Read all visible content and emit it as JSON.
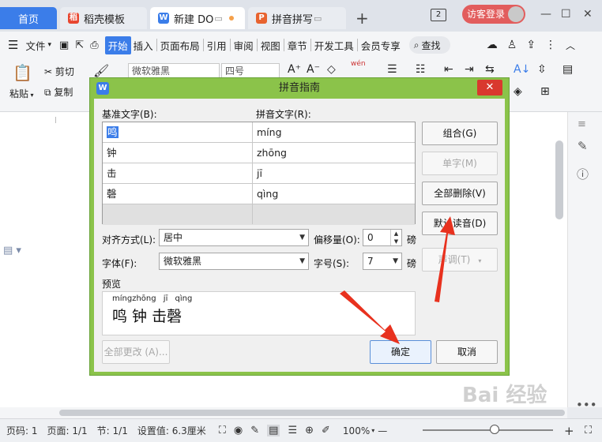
{
  "tabs": [
    {
      "label": "首页"
    },
    {
      "label": "稻壳模板"
    },
    {
      "label": "新建 DO"
    },
    {
      "label": "拼音拼写"
    }
  ],
  "tab_add": "+",
  "page_badge": "2",
  "login_label": "访客登录",
  "window": {
    "minimize": "—",
    "restore": "☐",
    "close": "✕"
  },
  "menu": {
    "file": "文件",
    "items": [
      "开始",
      "插入",
      "页面布局",
      "引用",
      "审阅",
      "视图",
      "章节",
      "开发工具",
      "会员专享"
    ],
    "search": "查找"
  },
  "ribbon": {
    "paste": "粘贴",
    "cut": "剪切",
    "copy": "复制",
    "font": "微软雅黑",
    "size": "四号",
    "wen": "wén"
  },
  "dialog": {
    "title": "拼音指南",
    "close": "✕",
    "base_label": "基准文字(B):",
    "pinyin_label": "拼音文字(R):",
    "rows": [
      {
        "base": "鸣",
        "pinyin": "míng"
      },
      {
        "base": "钟",
        "pinyin": "zhōng"
      },
      {
        "base": "击",
        "pinyin": "jī"
      },
      {
        "base": "磬",
        "pinyin": "qìng"
      }
    ],
    "buttons": {
      "combine": "组合(G)",
      "single": "单字(M)",
      "delete_all": "全部删除(V)",
      "default_reading": "默认读音(D)",
      "tone": "声调(T)",
      "change_all": "全部更改 (A)...",
      "ok": "确定",
      "cancel": "取消"
    },
    "align_label": "对齐方式(L):",
    "align_value": "居中",
    "offset_label": "偏移量(O):",
    "offset_value": "0",
    "offset_unit": "磅",
    "font_label": "字体(F):",
    "font_value": "微软雅黑",
    "size_label": "字号(S):",
    "size_value": "7",
    "size_unit": "磅",
    "preview_label": "预览",
    "preview_pinyin": [
      "míngzhōng",
      "jī",
      "qìng"
    ],
    "preview_text": "鸣 钟 击磬"
  },
  "status": {
    "page_no": "页码: 1",
    "pages": "页面: 1/1",
    "section": "节: 1/1",
    "setting": "设置值: 6.3厘米",
    "zoom": "100%",
    "zoom_minus": "—",
    "zoom_plus": "+"
  },
  "watermark": "Bai 经验"
}
